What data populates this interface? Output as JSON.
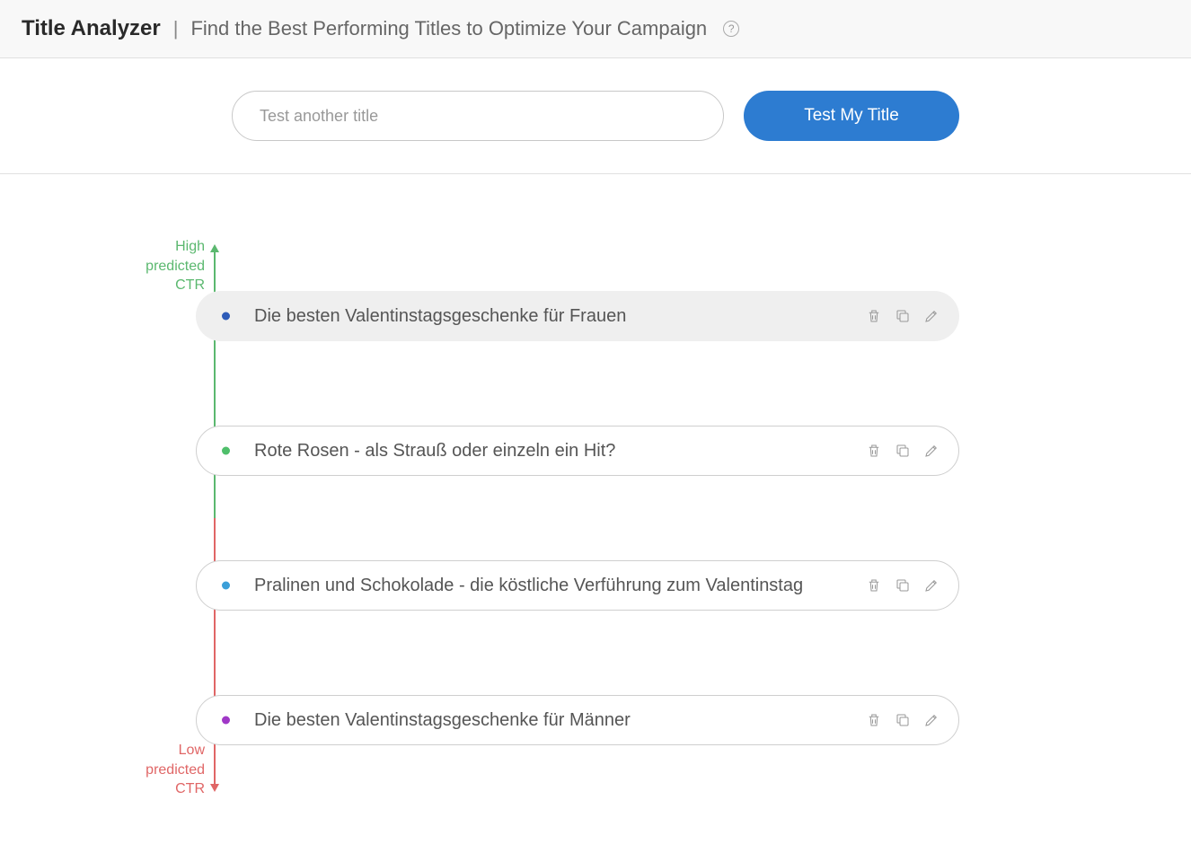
{
  "header": {
    "title": "Title Analyzer",
    "subtitle": "Find the Best Performing Titles to Optimize Your Campaign"
  },
  "search": {
    "placeholder": "Test another title",
    "button_label": "Test My Title"
  },
  "axis": {
    "high_label": "High predicted CTR",
    "low_label": "Low predicted CTR"
  },
  "titles": [
    {
      "text": "Die besten Valentinstagsgeschenke für Frauen",
      "dot_color": "blue-dark",
      "variant": "filled"
    },
    {
      "text": "Rote Rosen - als Strauß oder einzeln ein Hit?",
      "dot_color": "green",
      "variant": "outlined"
    },
    {
      "text": "Pralinen und Schokolade - die köstliche Verführung zum Valentinstag",
      "dot_color": "blue-light",
      "variant": "outlined"
    },
    {
      "text": "Die besten Valentinstagsgeschenke für Männer",
      "dot_color": "purple",
      "variant": "outlined"
    }
  ],
  "icons": {
    "delete": "delete-icon",
    "duplicate": "duplicate-icon",
    "edit": "edit-icon"
  }
}
